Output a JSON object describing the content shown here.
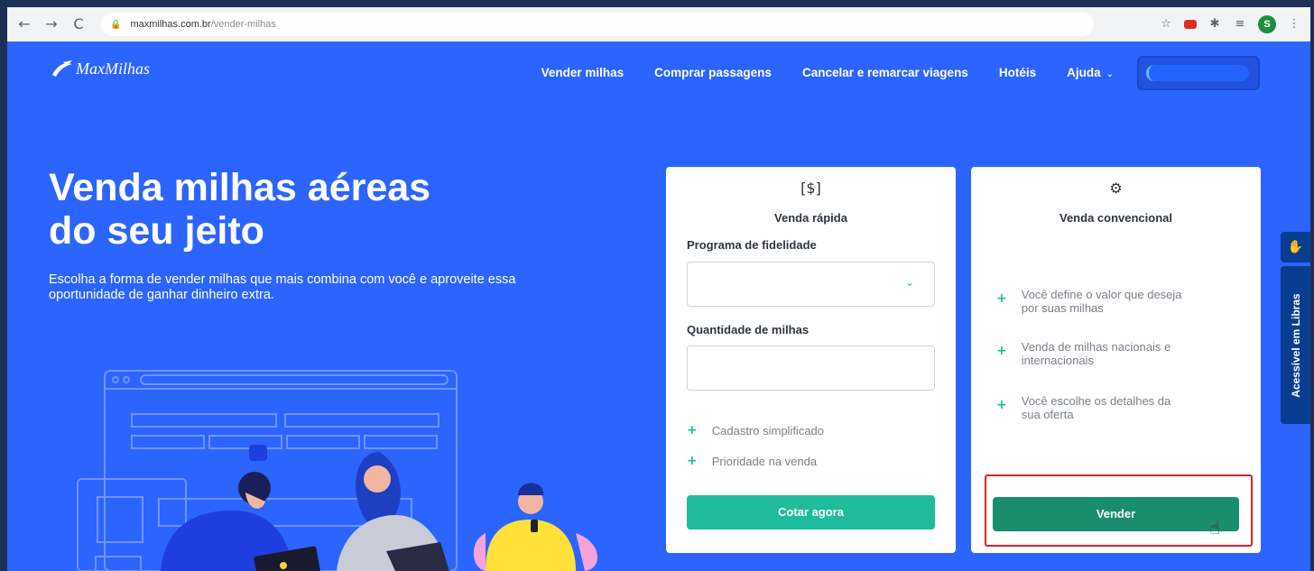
{
  "browser": {
    "back_icon": "arrow-left",
    "forward_icon": "arrow-right",
    "reload_icon": "reload",
    "url_domain": "maxmilhas.com.br",
    "url_path": "/vender-milhas",
    "profile_initial": "S"
  },
  "header": {
    "logo_text": "MaxMilhas",
    "nav": [
      "Vender milhas",
      "Comprar passagens",
      "Cancelar e remarcar viagens",
      "Hotéis",
      "Ajuda"
    ]
  },
  "hero": {
    "title_line1": "Venda milhas aéreas",
    "title_line2": "do seu jeito",
    "subtitle": "Escolha a forma de vender milhas que mais combina com você e aproveite essa oportunidade de ganhar dinheiro extra."
  },
  "quick_sale": {
    "title": "Venda rápida",
    "program_label": "Programa de fidelidade",
    "program_value": "",
    "miles_label": "Quantidade de milhas",
    "miles_value": "",
    "features": [
      "Cadastro simplificado",
      "Prioridade na venda"
    ],
    "button": "Cotar agora"
  },
  "conventional_sale": {
    "title": "Venda convencional",
    "features": [
      [
        "Você define o valor que deseja",
        "por suas milhas"
      ],
      [
        "Venda de milhas nacionais e",
        "internacionais"
      ],
      [
        "Você escolhe os detalhes da",
        "sua oferta"
      ]
    ],
    "button": "Vender"
  },
  "accessibility": {
    "libras_label": "Acessível em Libras"
  },
  "colors": {
    "page_bg": "#2b64ff",
    "teal_button": "#1fbb9c",
    "dark_teal_button": "#1a8d6e",
    "highlight_red": "#e0202a",
    "libras_blue": "#0a3d8f"
  }
}
